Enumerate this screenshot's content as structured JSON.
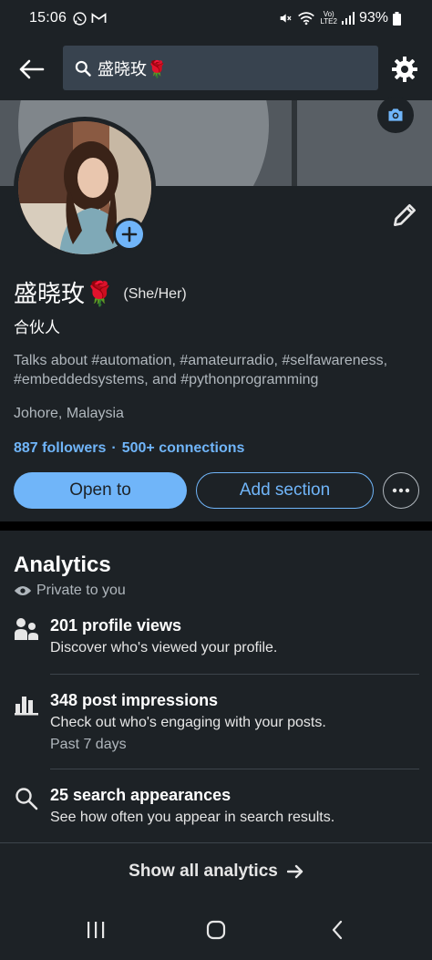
{
  "status_bar": {
    "time": "15:06",
    "battery_percent": "93%",
    "network": "LTE2",
    "left_icons": [
      "whatsapp-icon",
      "gmail-icon"
    ],
    "right_icons": [
      "mute-icon",
      "wifi-icon",
      "volte-icon",
      "signal-icon",
      "battery-icon"
    ]
  },
  "header": {
    "search_text": "盛晓玫🌹",
    "icons": [
      "back-arrow-icon",
      "search-icon",
      "settings-gear-icon"
    ]
  },
  "profile": {
    "name": "盛晓玫🌹",
    "pronouns": "(She/Her)",
    "headline": "合伙人",
    "about": "Talks about #automation, #amateurradio, #selfawareness, #embeddedsystems, and #pythonprogramming",
    "location": "Johore, Malaysia",
    "followers": "887 followers",
    "separator": "·",
    "connections": "500+ connections",
    "buttons": {
      "open_to": "Open to",
      "add_section": "Add section"
    },
    "icons": [
      "camera-icon",
      "add-photo-icon",
      "edit-pencil-icon",
      "more-options-icon"
    ]
  },
  "analytics": {
    "title": "Analytics",
    "privacy": "Private to you",
    "items": [
      {
        "icon": "people-icon",
        "title": "201 profile views",
        "subtitle": "Discover who's viewed your profile."
      },
      {
        "icon": "bar-chart-icon",
        "title": "348 post impressions",
        "subtitle": "Check out who's engaging with your posts.",
        "note": "Past 7 days"
      },
      {
        "icon": "search-icon",
        "title": "25 search appearances",
        "subtitle": "See how often you appear in search results."
      }
    ],
    "show_all": "Show all analytics"
  },
  "colors": {
    "background": "#1d2226",
    "accent_blue": "#70b5f9",
    "text_primary": "#ffffff",
    "text_secondary": "#b0b7bd"
  }
}
